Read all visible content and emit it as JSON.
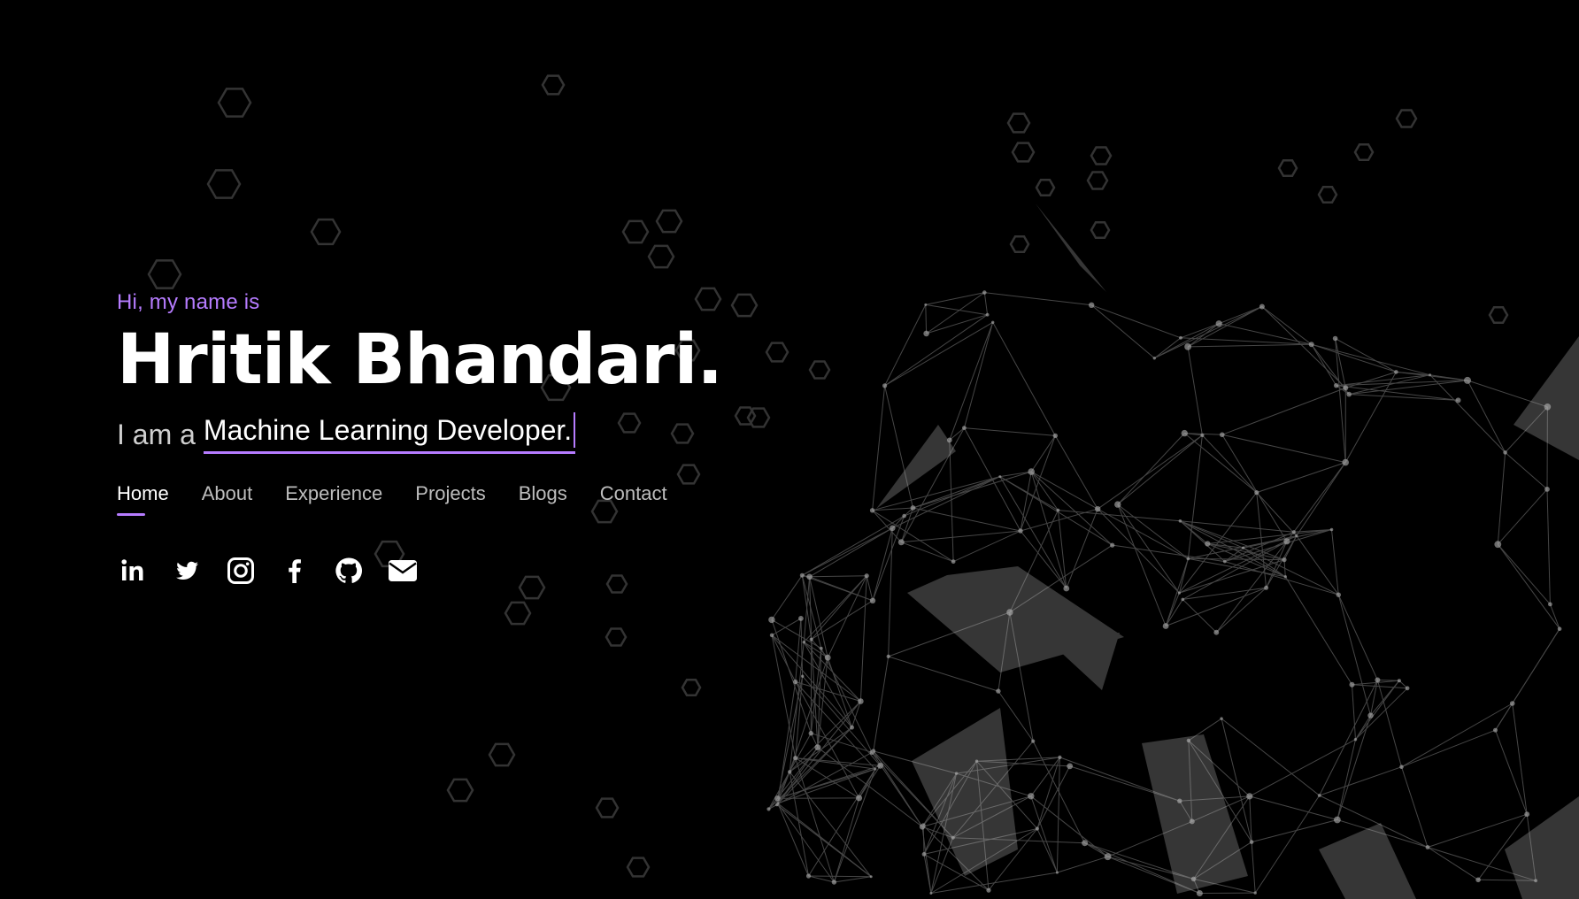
{
  "hero": {
    "greeting": "Hi, my name is",
    "name": "Hritik Bhandari.",
    "role_prefix": "I am a",
    "role_typed": "Machine Learning Developer."
  },
  "nav": {
    "items": [
      {
        "label": "Home",
        "active": true
      },
      {
        "label": "About",
        "active": false
      },
      {
        "label": "Experience",
        "active": false
      },
      {
        "label": "Projects",
        "active": false
      },
      {
        "label": "Blogs",
        "active": false
      },
      {
        "label": "Contact",
        "active": false
      }
    ]
  },
  "socials": [
    {
      "icon": "linkedin-icon"
    },
    {
      "icon": "twitter-icon"
    },
    {
      "icon": "instagram-icon"
    },
    {
      "icon": "facebook-icon"
    },
    {
      "icon": "github-icon"
    },
    {
      "icon": "mail-icon"
    }
  ],
  "colors": {
    "background": "#000000",
    "accent": "#b67cff",
    "text": "#ffffff",
    "muted": "#bdbdbd",
    "particle": "#8a8a8a"
  }
}
